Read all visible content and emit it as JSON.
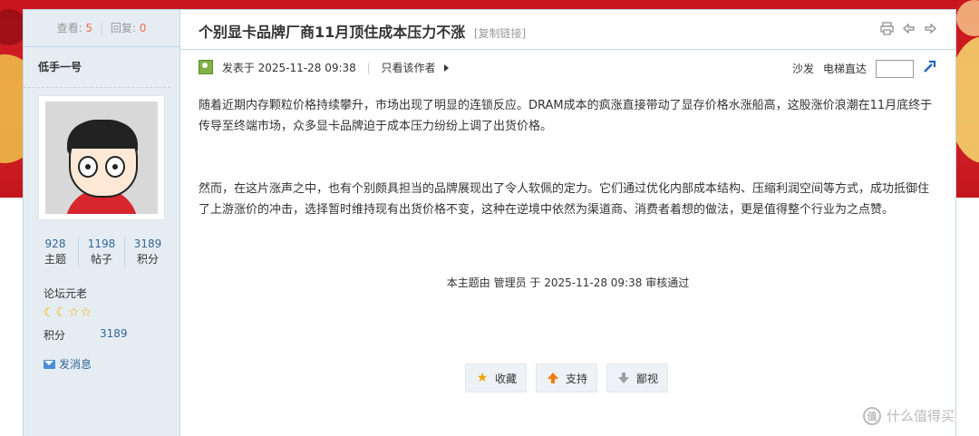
{
  "stats": {
    "views_label": "查看:",
    "views": "5",
    "replies_label": "回复:",
    "replies": "0"
  },
  "author": {
    "name": "低手一号"
  },
  "user_counts": [
    {
      "value": "928",
      "label": "主题"
    },
    {
      "value": "1198",
      "label": "帖子"
    },
    {
      "value": "3189",
      "label": "积分"
    }
  ],
  "rank": {
    "title": "论坛元老",
    "stars": "☾☾☆☆"
  },
  "score": {
    "label": "积分",
    "value": "3189"
  },
  "send_message": "发消息",
  "thread": {
    "title": "个别显卡品牌厂商11月顶住成本压力不涨",
    "copy_link": "[复制链接]"
  },
  "post": {
    "posted_at": "发表于 2025-11-28 09:38",
    "only_author": "只看该作者",
    "floor_label": "沙发",
    "elevator_label": "电梯直达",
    "paragraphs": [
      "随着近期内存颗粒价格持续攀升，市场出现了明显的连锁反应。DRAM成本的疯涨直接带动了显存价格水涨船高，这股涨价浪潮在11月底终于传导至终端市场，众多显卡品牌迫于成本压力纷纷上调了出货价格。",
      "然而，在这片涨声之中，也有个别颇具担当的品牌展现出了令人软佩的定力。它们通过优化内部成本结构、压缩利润空间等方式，成功抵御住了上游涨价的冲击，选择暂时维持现有出货价格不变，这种在逆境中依然为渠道商、消费者着想的做法，更是值得整个行业为之点赞。"
    ],
    "review_note": "本主题由 管理员 于 2025-11-28 09:38 审核通过"
  },
  "actions": {
    "favorite": "收藏",
    "support": "支持",
    "oppose": "鄙视"
  },
  "watermark": "什么值得买",
  "icons": [
    "print-icon",
    "prev-thread-icon",
    "next-thread-icon",
    "online-status-icon",
    "go-icon",
    "mail-icon",
    "star-icon",
    "thumb-up-icon",
    "thumb-down-icon"
  ]
}
